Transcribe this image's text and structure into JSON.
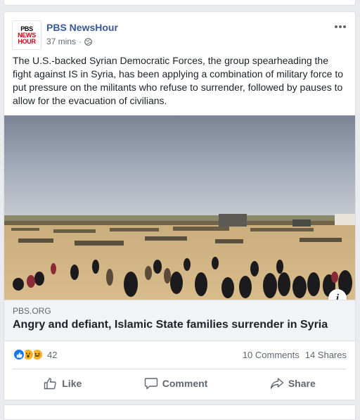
{
  "post": {
    "page_name": "PBS NewsHour",
    "logo_lines": [
      "PBS",
      "NEWS",
      "HOUR"
    ],
    "time": "37 mins",
    "meta_separator": "·",
    "privacy_icon": "globe-icon",
    "more_icon": "ellipsis-icon",
    "text": "The U.S.-backed Syrian Democratic Forces, the group spearheading the fight against IS in Syria, has been applying a combination of military force to put pressure on the militants who refuse to surrender, followed by pauses to allow for the evacuation of civilians."
  },
  "link": {
    "domain": "PBS.ORG",
    "title": "Angry and defiant, Islamic State families surrender in Syria",
    "info_label": "i"
  },
  "stats": {
    "reaction_icons": [
      "like-reaction-icon",
      "wow-reaction-icon",
      "haha-reaction-icon"
    ],
    "reaction_count": "42",
    "comments": "10 Comments",
    "shares": "14 Shares"
  },
  "actions": {
    "like": "Like",
    "comment": "Comment",
    "share": "Share"
  },
  "colors": {
    "page_bg": "#e9ebee",
    "link_blue": "#385898",
    "like_blue": "#1877f2",
    "muted": "#606770"
  }
}
